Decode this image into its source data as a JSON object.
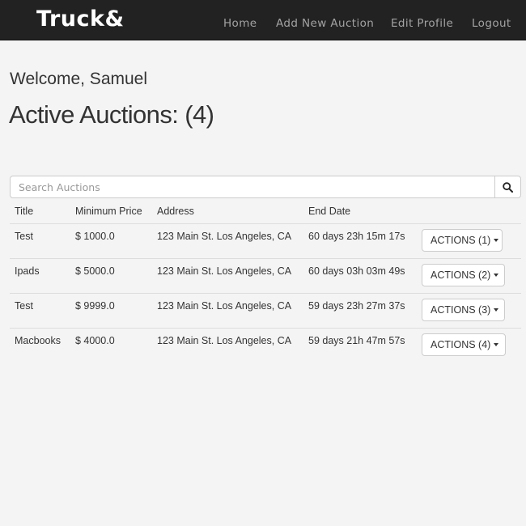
{
  "navbar": {
    "brand": "Truck&",
    "links": [
      "Home",
      "Add New Auction",
      "Edit Profile",
      "Logout"
    ]
  },
  "welcome": "Welcome, Samuel",
  "heading": "Active Auctions: (4)",
  "search": {
    "placeholder": "Search Auctions",
    "value": ""
  },
  "icons": {
    "search": "search-icon",
    "caret": "caret-down-icon"
  },
  "table": {
    "headers": [
      "Title",
      "Minimum Price",
      "Address",
      "End Date"
    ],
    "rows": [
      {
        "title": "Test",
        "price": "$ 1000.0",
        "address": "123 Main St. Los Angeles, CA",
        "end": "60 days 23h 15m 17s",
        "action": "ACTIONS (1)"
      },
      {
        "title": "Ipads",
        "price": "$ 5000.0",
        "address": "123 Main St. Los Angeles, CA",
        "end": "60 days 03h 03m 49s",
        "action": "ACTIONS (2)"
      },
      {
        "title": "Test",
        "price": "$ 9999.0",
        "address": "123 Main St. Los Angeles, CA",
        "end": "59 days 23h 27m 37s",
        "action": "ACTIONS (3)"
      },
      {
        "title": "Macbooks",
        "price": "$ 4000.0",
        "address": "123 Main St. Los Angeles, CA",
        "end": "59 days 21h 47m 57s",
        "action": "ACTIONS (4)"
      }
    ]
  }
}
